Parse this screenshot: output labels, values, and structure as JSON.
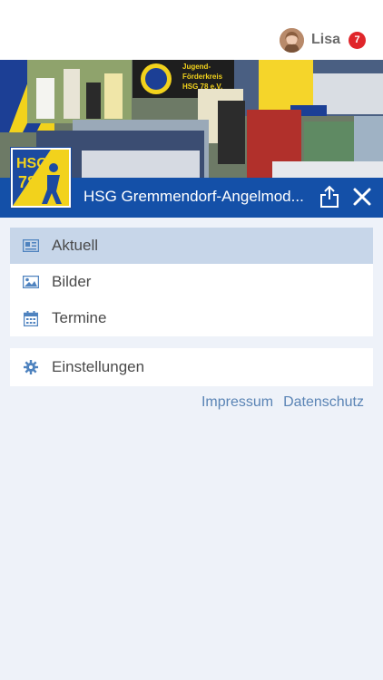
{
  "user": {
    "name": "Lisa",
    "notification_count": "7"
  },
  "club": {
    "title": "HSG Gremmendorf-Angelmod...",
    "logo_text": "HSG 78"
  },
  "banner": {
    "sign_text": [
      "Jugend-",
      "Förderkreis",
      "HSG 78 e.V."
    ]
  },
  "menu": {
    "primary": [
      {
        "label": "Aktuell",
        "icon": "newspaper-icon",
        "active": true
      },
      {
        "label": "Bilder",
        "icon": "image-icon",
        "active": false
      },
      {
        "label": "Termine",
        "icon": "calendar-icon",
        "active": false
      }
    ],
    "secondary": [
      {
        "label": "Einstellungen",
        "icon": "gear-icon",
        "active": false
      }
    ]
  },
  "footer_links": {
    "impressum": "Impressum",
    "datenschutz": "Datenschutz"
  },
  "colors": {
    "primary_blue": "#1450a8",
    "active_item": "#c7d6e9",
    "icon_blue": "#4f83bf",
    "link": "#5a84b5",
    "badge": "#e0262b",
    "background": "#eef2f9"
  }
}
